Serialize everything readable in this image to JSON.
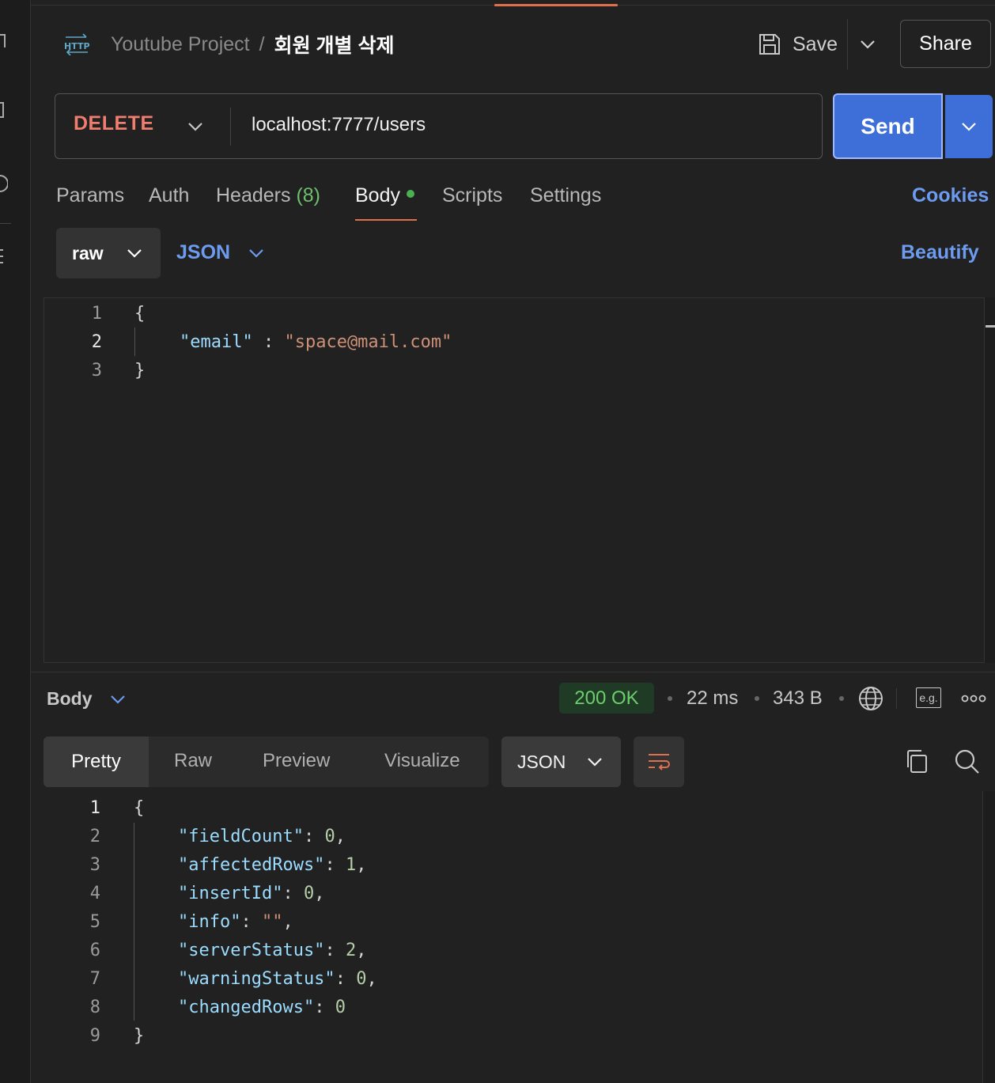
{
  "header": {
    "protocol_icon": "http-icon",
    "project": "Youtube Project",
    "separator": "/",
    "request_title": "회원 개별 삭제",
    "save_label": "Save",
    "share_label": "Share"
  },
  "request": {
    "method": "DELETE",
    "url": "localhost:7777/users",
    "send_label": "Send"
  },
  "tabs": [
    {
      "label": "Params"
    },
    {
      "label": "Auth"
    },
    {
      "label": "Headers",
      "count": "(8)"
    },
    {
      "label": "Body",
      "active": true
    },
    {
      "label": "Scripts"
    },
    {
      "label": "Settings"
    }
  ],
  "cookies_label": "Cookies",
  "body_options": {
    "mode": "raw",
    "language": "JSON",
    "beautify_label": "Beautify"
  },
  "request_body": {
    "lines": [
      {
        "n": "1",
        "text": "{"
      },
      {
        "n": "2",
        "key": "\"email\"",
        "sep": " : ",
        "value": "\"space@mail.com\""
      },
      {
        "n": "3",
        "text": "}"
      }
    ]
  },
  "response": {
    "body_label": "Body",
    "status": "200 OK",
    "time": "22 ms",
    "size": "343 B",
    "example_badge": "e.g.",
    "view_tabs": [
      "Pretty",
      "Raw",
      "Preview",
      "Visualize"
    ],
    "active_view": "Pretty",
    "format": "JSON",
    "lines": [
      {
        "n": "1",
        "text": "{"
      },
      {
        "n": "2",
        "key": "\"fieldCount\"",
        "value": "0",
        "trail": ","
      },
      {
        "n": "3",
        "key": "\"affectedRows\"",
        "value": "1",
        "trail": ","
      },
      {
        "n": "4",
        "key": "\"insertId\"",
        "value": "0",
        "trail": ","
      },
      {
        "n": "5",
        "key": "\"info\"",
        "value": "\"\"",
        "trail": ","
      },
      {
        "n": "6",
        "key": "\"serverStatus\"",
        "value": "2",
        "trail": ","
      },
      {
        "n": "7",
        "key": "\"warningStatus\"",
        "value": "0",
        "trail": ","
      },
      {
        "n": "8",
        "key": "\"changedRows\"",
        "value": "0",
        "trail": ""
      },
      {
        "n": "9",
        "text": "}"
      }
    ]
  },
  "colors": {
    "accent_orange": "#e0704c",
    "send_blue": "#3e6fd8",
    "link_blue": "#6d9bf0",
    "status_green": "#6ccf6c",
    "method_red": "#f07e6e"
  }
}
